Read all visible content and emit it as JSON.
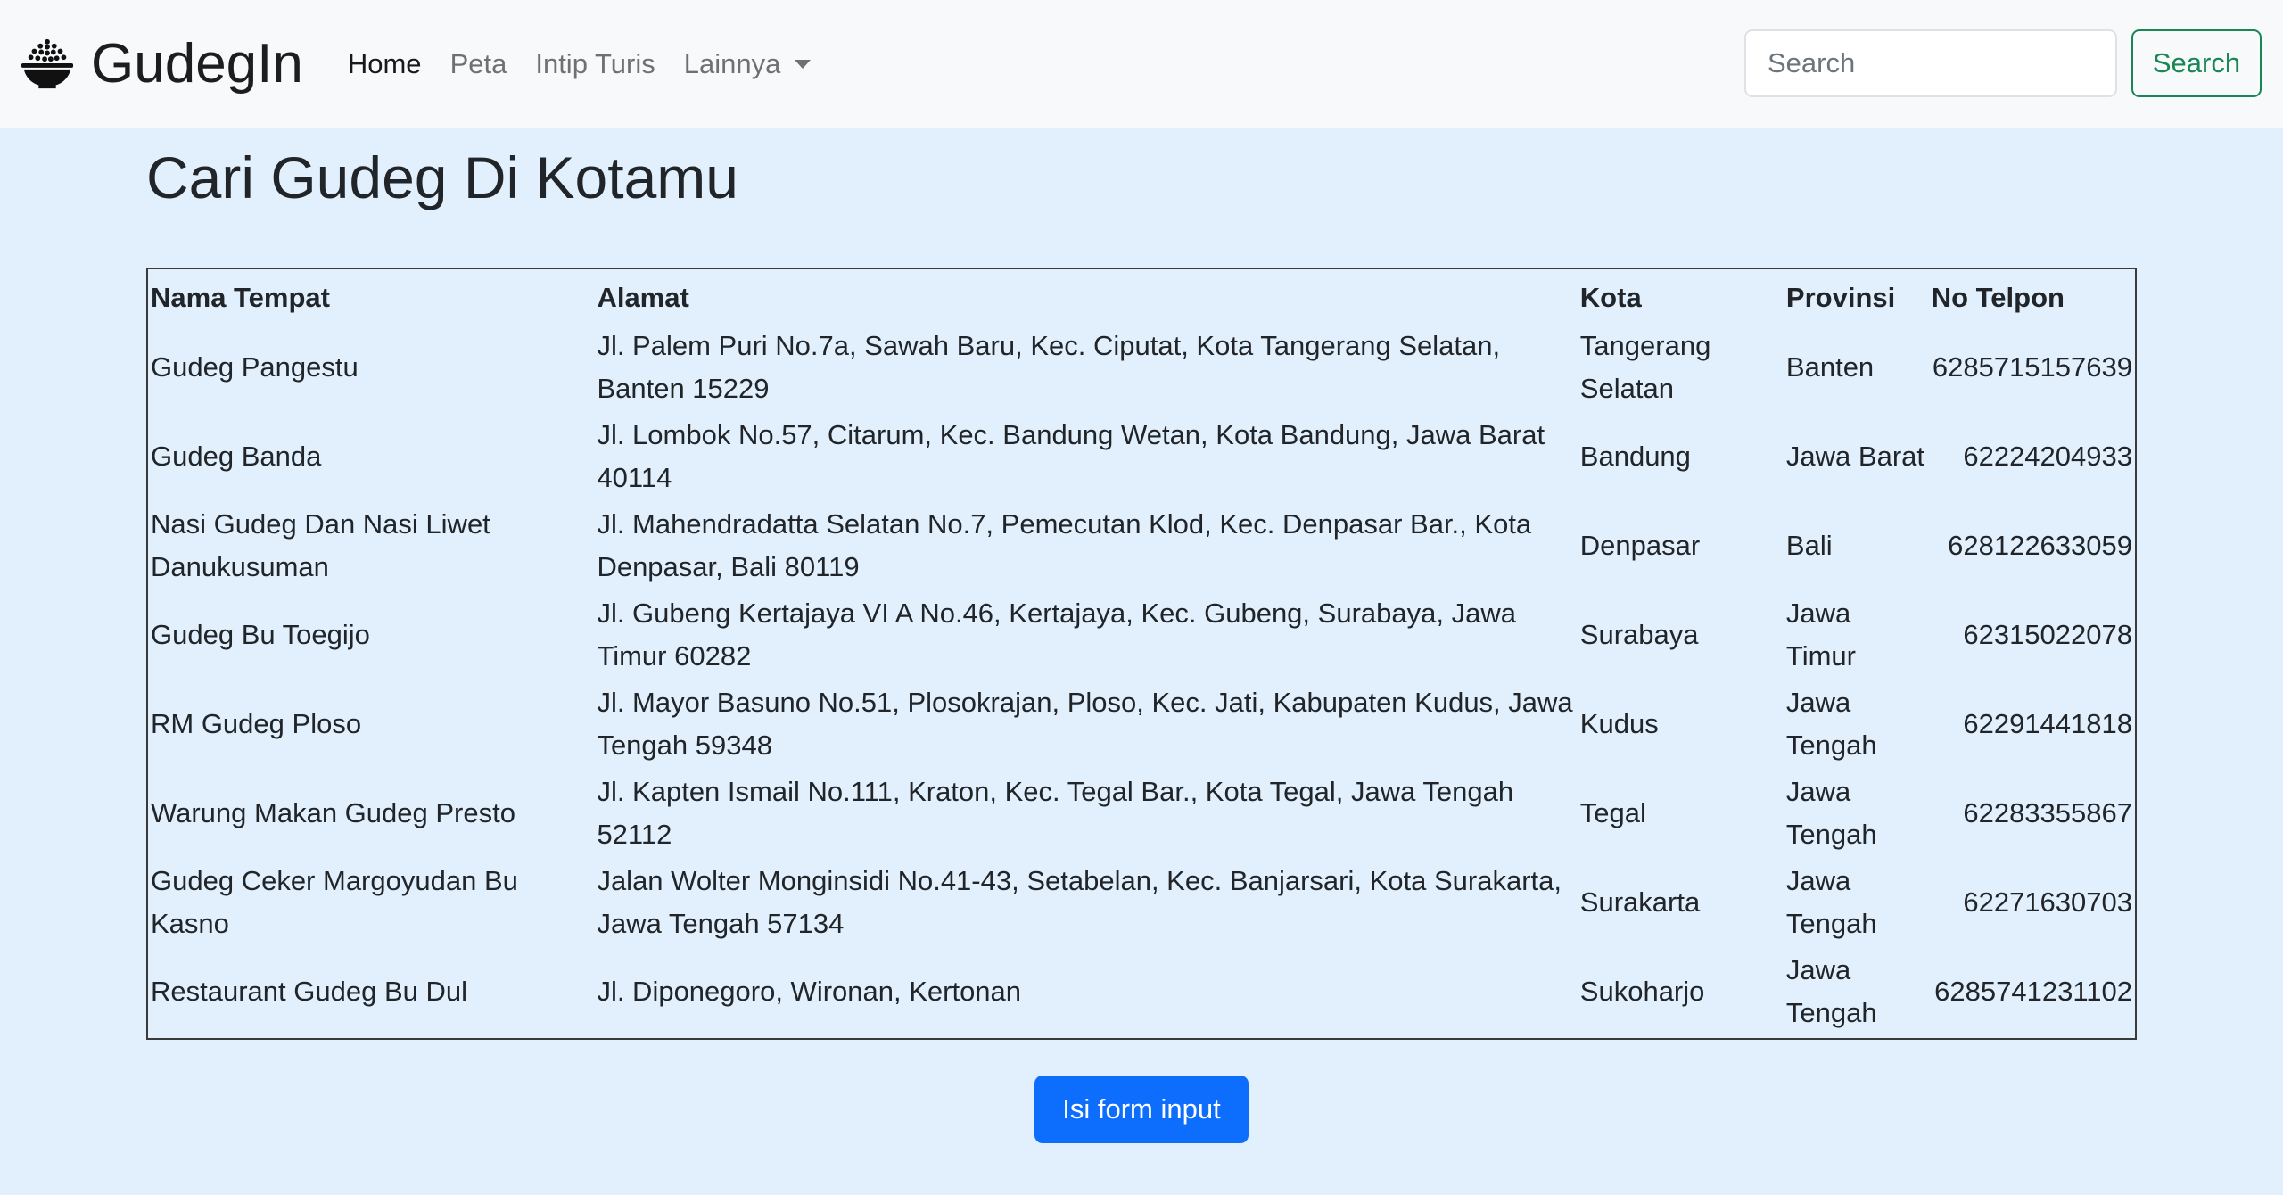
{
  "navbar": {
    "brand": "GudegIn",
    "brand_icon": "rice-bowl-icon",
    "links": [
      {
        "label": "Home",
        "active": true
      },
      {
        "label": "Peta",
        "active": false
      },
      {
        "label": "Intip Turis",
        "active": false
      },
      {
        "label": "Lainnya",
        "active": false,
        "dropdown": true
      }
    ],
    "search_placeholder": "Search",
    "search_button": "Search"
  },
  "main": {
    "title": "Cari Gudeg Di Kotamu",
    "table": {
      "headers": [
        "Nama Tempat",
        "Alamat",
        "Kota",
        "Provinsi",
        "No Telpon"
      ],
      "rows": [
        [
          "Gudeg Pangestu",
          "Jl. Palem Puri No.7a, Sawah Baru, Kec. Ciputat, Kota Tangerang Selatan, Banten 15229",
          "Tangerang Selatan",
          "Banten",
          "6285715157639"
        ],
        [
          "Gudeg Banda",
          "Jl. Lombok No.57, Citarum, Kec. Bandung Wetan, Kota Bandung, Jawa Barat 40114",
          "Bandung",
          "Jawa Barat",
          "62224204933"
        ],
        [
          "Nasi Gudeg Dan Nasi Liwet Danukusuman",
          "Jl. Mahendradatta Selatan No.7, Pemecutan Klod, Kec. Denpasar Bar., Kota Denpasar, Bali 80119",
          "Denpasar",
          "Bali",
          "628122633059"
        ],
        [
          "Gudeg Bu Toegijo",
          "Jl. Gubeng Kertajaya VI A No.46, Kertajaya, Kec. Gubeng, Surabaya, Jawa Timur 60282",
          "Surabaya",
          "Jawa Timur",
          "62315022078"
        ],
        [
          "RM Gudeg Ploso",
          "Jl. Mayor Basuno No.51, Plosokrajan, Ploso, Kec. Jati, Kabupaten Kudus, Jawa Tengah 59348",
          "Kudus",
          "Jawa Tengah",
          "62291441818"
        ],
        [
          "Warung Makan Gudeg Presto",
          "Jl. Kapten Ismail No.111, Kraton, Kec. Tegal Bar., Kota Tegal, Jawa Tengah 52112",
          "Tegal",
          "Jawa Tengah",
          "62283355867"
        ],
        [
          "Gudeg Ceker Margoyudan Bu Kasno",
          "Jalan Wolter Monginsidi No.41-43, Setabelan, Kec. Banjarsari, Kota Surakarta, Jawa Tengah 57134",
          "Surakarta",
          "Jawa Tengah",
          "62271630703"
        ],
        [
          "Restaurant Gudeg Bu Dul",
          "Jl. Diponegoro, Wironan, Kertonan",
          "Sukoharjo",
          "Jawa Tengah",
          "6285741231102"
        ]
      ]
    },
    "form_button": "Isi form input"
  },
  "colors": {
    "navbar_bg": "#f8f9fa",
    "page_bg": "#e1f0fc",
    "primary": "#0d6efd",
    "success": "#198754"
  }
}
